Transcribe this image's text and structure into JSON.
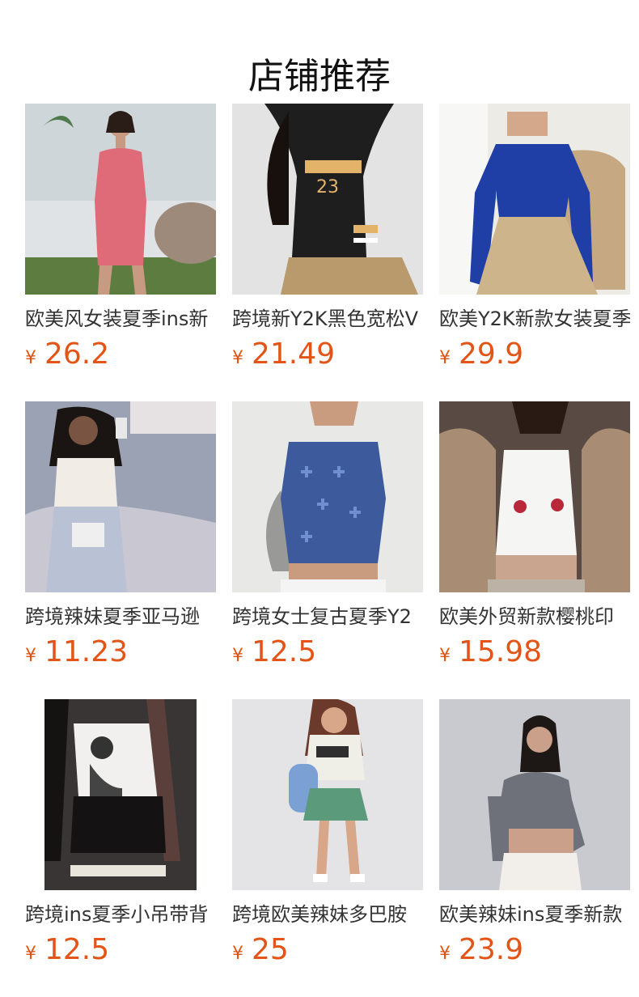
{
  "section": {
    "title": "店铺推荐"
  },
  "currency_symbol": "¥",
  "colors": {
    "price": "#e35517",
    "title": "#111111",
    "name": "#333333"
  },
  "products": [
    {
      "name": "欧美风女装夏季ins新",
      "price": "26.2",
      "image": "pink-ruched-dress"
    },
    {
      "name": "跨境新Y2K黑色宽松V",
      "price": "21.49",
      "image": "black-jersey-top"
    },
    {
      "name": "欧美Y2K新款女装夏季",
      "price": "29.9",
      "image": "blue-long-sleeve-top"
    },
    {
      "name": "跨境辣妹夏季亚马逊",
      "price": "11.23",
      "image": "white-crop-top-selfie"
    },
    {
      "name": "跨境女士复古夏季Y2",
      "price": "12.5",
      "image": "blue-cross-print-tank"
    },
    {
      "name": "欧美外贸新款樱桃印",
      "price": "15.98",
      "image": "cherry-print-tank"
    },
    {
      "name": "跨境ins夏季小吊带背",
      "price": "12.5",
      "image": "graphic-print-tube-top"
    },
    {
      "name": "跨境欧美辣妹多巴胺",
      "price": "25",
      "image": "ringer-tee-green-shorts"
    },
    {
      "name": "欧美辣妹ins夏季新款",
      "price": "23.9",
      "image": "grey-cutout-top"
    }
  ]
}
